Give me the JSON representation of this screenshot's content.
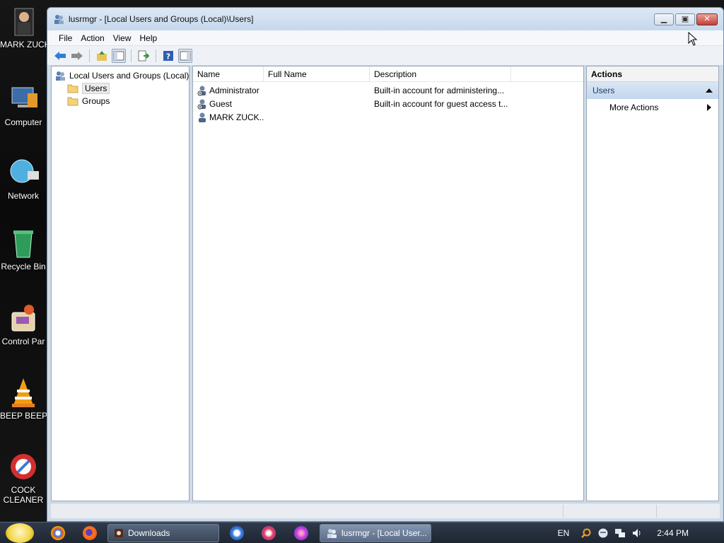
{
  "desktop": {
    "icons": [
      {
        "label": "MARK ZUCKERBER",
        "icon": "user-folder-icon"
      },
      {
        "label": "Computer",
        "icon": "computer-icon"
      },
      {
        "label": "Network",
        "icon": "network-globe-icon"
      },
      {
        "label": "Recycle Bin",
        "icon": "recycle-bin-icon"
      },
      {
        "label": "Control Par",
        "icon": "control-panel-icon"
      },
      {
        "label": "BEEP BEEP",
        "icon": "vlc-cone-icon"
      },
      {
        "label": "COCK CLEANER",
        "icon": "cleaner-icon"
      }
    ]
  },
  "window": {
    "title": "lusrmgr - [Local Users and Groups (Local)\\Users]",
    "menu": [
      "File",
      "Action",
      "View",
      "Help"
    ]
  },
  "tree": {
    "root": "Local Users and Groups (Local)",
    "children": [
      "Users",
      "Groups"
    ]
  },
  "list": {
    "columns": [
      "Name",
      "Full Name",
      "Description"
    ],
    "rows": [
      {
        "name": "Administrator",
        "full_name": "",
        "description": "Built-in account for administering..."
      },
      {
        "name": "Guest",
        "full_name": "",
        "description": "Built-in account for guest access t..."
      },
      {
        "name": "MARK ZUCK...",
        "full_name": "",
        "description": ""
      }
    ]
  },
  "actions": {
    "title": "Actions",
    "section": "Users",
    "items": [
      "More Actions"
    ]
  },
  "taskbar": {
    "tasks": [
      "Downloads",
      "lusrmgr - [Local User..."
    ],
    "language": "EN",
    "time": "2:44 PM"
  }
}
